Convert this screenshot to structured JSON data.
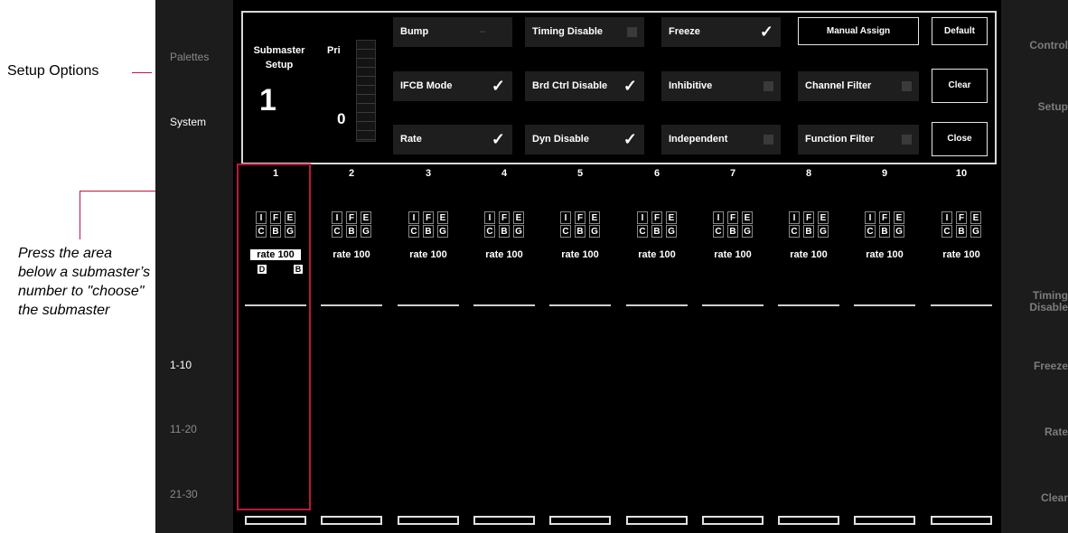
{
  "annotations": {
    "setup_options": "Setup Options",
    "press_note": "Press the area below a submaster’s number to \"choose\" the submaster"
  },
  "left_column": {
    "items": [
      "Palettes",
      "System",
      "1-10",
      "11-20",
      "21-30"
    ]
  },
  "right_column": {
    "items": [
      "Control",
      "Setup",
      "Timing Disable",
      "Freeze",
      "Rate",
      "Clear"
    ]
  },
  "setup_panel": {
    "title_line1": "Submaster",
    "title_line2": "Setup",
    "sub_number": "1",
    "pri_label": "Pri",
    "pri_value": "0",
    "options": [
      {
        "label": "Bump",
        "state": "dash"
      },
      {
        "label": "IFCB Mode",
        "state": "checked"
      },
      {
        "label": "Rate",
        "state": "checked"
      },
      {
        "label": "Timing Disable",
        "state": "off"
      },
      {
        "label": "Brd Ctrl Disable",
        "state": "checked"
      },
      {
        "label": "Dyn Disable",
        "state": "checked"
      },
      {
        "label": "Freeze",
        "state": "checked"
      },
      {
        "label": "Inhibitive",
        "state": "off"
      },
      {
        "label": "Independent",
        "state": "off"
      },
      {
        "label": "Channel Filter",
        "state": "off"
      },
      {
        "label": "Function Filter",
        "state": "off"
      }
    ],
    "buttons": {
      "manual_assign": "Manual Assign",
      "default": "Default",
      "clear": "Clear",
      "close": "Close"
    }
  },
  "flags": {
    "row1": [
      "I",
      "F",
      "E"
    ],
    "row2": [
      "C",
      "B",
      "G"
    ]
  },
  "check_mark": "✓",
  "submasters": [
    {
      "number": "1",
      "rate": "rate 100",
      "selected": true,
      "markers": [
        "D",
        "B"
      ]
    },
    {
      "number": "2",
      "rate": "rate 100"
    },
    {
      "number": "3",
      "rate": "rate 100"
    },
    {
      "number": "4",
      "rate": "rate 100"
    },
    {
      "number": "5",
      "rate": "rate 100"
    },
    {
      "number": "6",
      "rate": "rate 100"
    },
    {
      "number": "7",
      "rate": "rate 100"
    },
    {
      "number": "8",
      "rate": "rate 100"
    },
    {
      "number": "9",
      "rate": "rate 100"
    },
    {
      "number": "10",
      "rate": "rate 100"
    }
  ],
  "colors": {
    "highlight": "#c0143c",
    "screen_bg": "#000000",
    "panel_border": "#d8d8d8"
  }
}
